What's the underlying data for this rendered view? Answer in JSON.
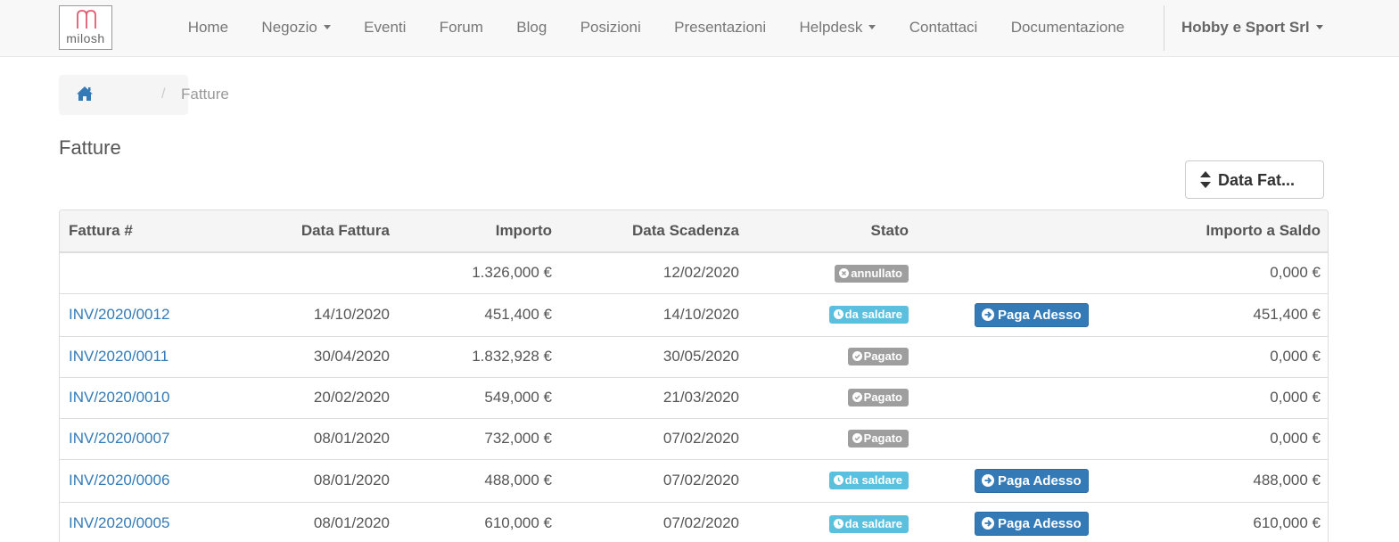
{
  "brand": {
    "logo_text": "milosh",
    "logo_accent": "#e05a70"
  },
  "nav": {
    "items": [
      {
        "label": "Home",
        "dropdown": false
      },
      {
        "label": "Negozio",
        "dropdown": true
      },
      {
        "label": "Eventi",
        "dropdown": false
      },
      {
        "label": "Forum",
        "dropdown": false
      },
      {
        "label": "Blog",
        "dropdown": false
      },
      {
        "label": "Posizioni",
        "dropdown": false
      },
      {
        "label": "Presentazioni",
        "dropdown": false
      },
      {
        "label": "Helpdesk",
        "dropdown": true
      },
      {
        "label": "Contattaci",
        "dropdown": false
      },
      {
        "label": "Documentazione",
        "dropdown": false
      }
    ],
    "user": "Hobby e Sport Srl"
  },
  "breadcrumb": {
    "current": "Fatture",
    "separator": "/"
  },
  "page": {
    "title": "Fatture"
  },
  "sort": {
    "label": "Data Fat..."
  },
  "table": {
    "headers": {
      "invoice": "Fattura #",
      "invoice_date": "Data Fattura",
      "amount": "Importo",
      "due_date": "Data Scadenza",
      "status": "Stato",
      "balance": "Importo a Saldo"
    },
    "rows": [
      {
        "invoice": "",
        "invoice_date": "",
        "amount": "1.326,000 €",
        "due_date": "12/02/2020",
        "status": "annullato",
        "status_kind": "cancelled",
        "action": "",
        "balance": "0,000 €"
      },
      {
        "invoice": "INV/2020/0012",
        "invoice_date": "14/10/2020",
        "amount": "451,400 €",
        "due_date": "14/10/2020",
        "status": "da saldare",
        "status_kind": "due",
        "action": "Paga Adesso",
        "balance": "451,400 €"
      },
      {
        "invoice": "INV/2020/0011",
        "invoice_date": "30/04/2020",
        "amount": "1.832,928 €",
        "due_date": "30/05/2020",
        "status": "Pagato",
        "status_kind": "paid",
        "action": "",
        "balance": "0,000 €"
      },
      {
        "invoice": "INV/2020/0010",
        "invoice_date": "20/02/2020",
        "amount": "549,000 €",
        "due_date": "21/03/2020",
        "status": "Pagato",
        "status_kind": "paid",
        "action": "",
        "balance": "0,000 €"
      },
      {
        "invoice": "INV/2020/0007",
        "invoice_date": "08/01/2020",
        "amount": "732,000 €",
        "due_date": "07/02/2020",
        "status": "Pagato",
        "status_kind": "paid",
        "action": "",
        "balance": "0,000 €"
      },
      {
        "invoice": "INV/2020/0006",
        "invoice_date": "08/01/2020",
        "amount": "488,000 €",
        "due_date": "07/02/2020",
        "status": "da saldare",
        "status_kind": "due",
        "action": "Paga Adesso",
        "balance": "488,000 €"
      },
      {
        "invoice": "INV/2020/0005",
        "invoice_date": "08/01/2020",
        "amount": "610,000 €",
        "due_date": "07/02/2020",
        "status": "da saldare",
        "status_kind": "due",
        "action": "Paga Adesso",
        "balance": "610,000 €"
      }
    ]
  },
  "colors": {
    "link": "#337ab7",
    "badge_grey": "#9e9e9e",
    "badge_due": "#5bc0de",
    "primary_button": "#337ab7"
  }
}
